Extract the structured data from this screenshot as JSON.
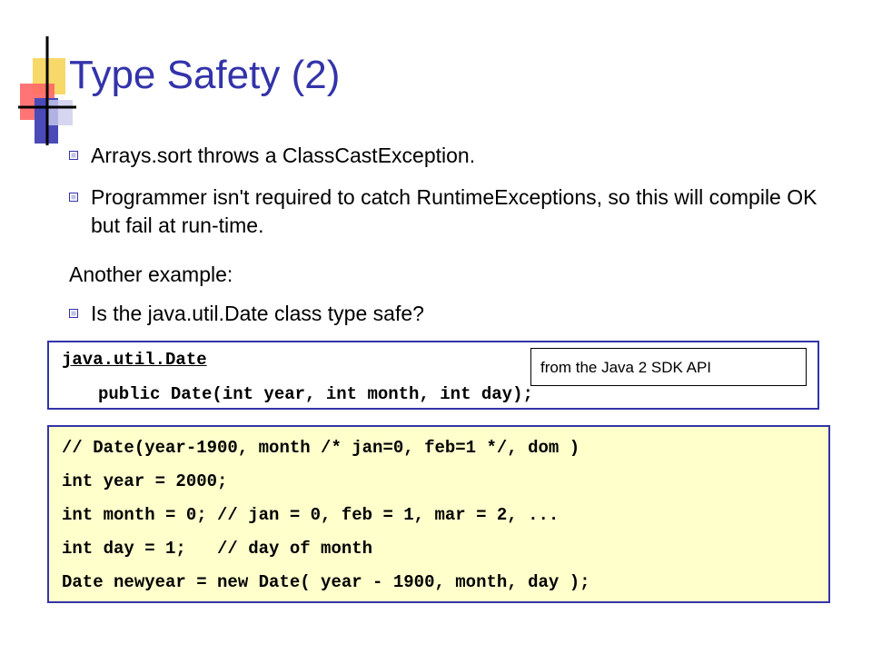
{
  "slide": {
    "title": "Type Safety (2)",
    "bullets": [
      {
        "style": "square",
        "text": "Arrays.sort throws a ClassCastException."
      },
      {
        "style": "square",
        "text": "Programmer isn't required to catch RuntimeExceptions, so this will compile OK but fail at run-time."
      },
      {
        "style": "none",
        "text": "Another example:"
      },
      {
        "style": "square",
        "text": "Is the java.util.Date class type safe?"
      }
    ],
    "api_box": {
      "class_name": "java.util.Date",
      "signature": "public Date(int year, int month, int day);"
    },
    "note": "from the Java 2 SDK API",
    "example_code": [
      "// Date(year-1900, month /* jan=0, feb=1 */, dom )",
      "int year = 2000;",
      "int month = 0; // jan = 0, feb = 1, mar = 2, ...",
      "int day = 1;   // day of month",
      "Date newyear = new Date( year - 1900, month, day );"
    ]
  },
  "colors": {
    "title": "#3333aa",
    "code_box_border": "#3333aa",
    "code_box_fill": "#ffffcc",
    "logo_yellow": "#f7d96a",
    "logo_red": "#ff3333",
    "logo_blue": "#4a4ab8"
  }
}
